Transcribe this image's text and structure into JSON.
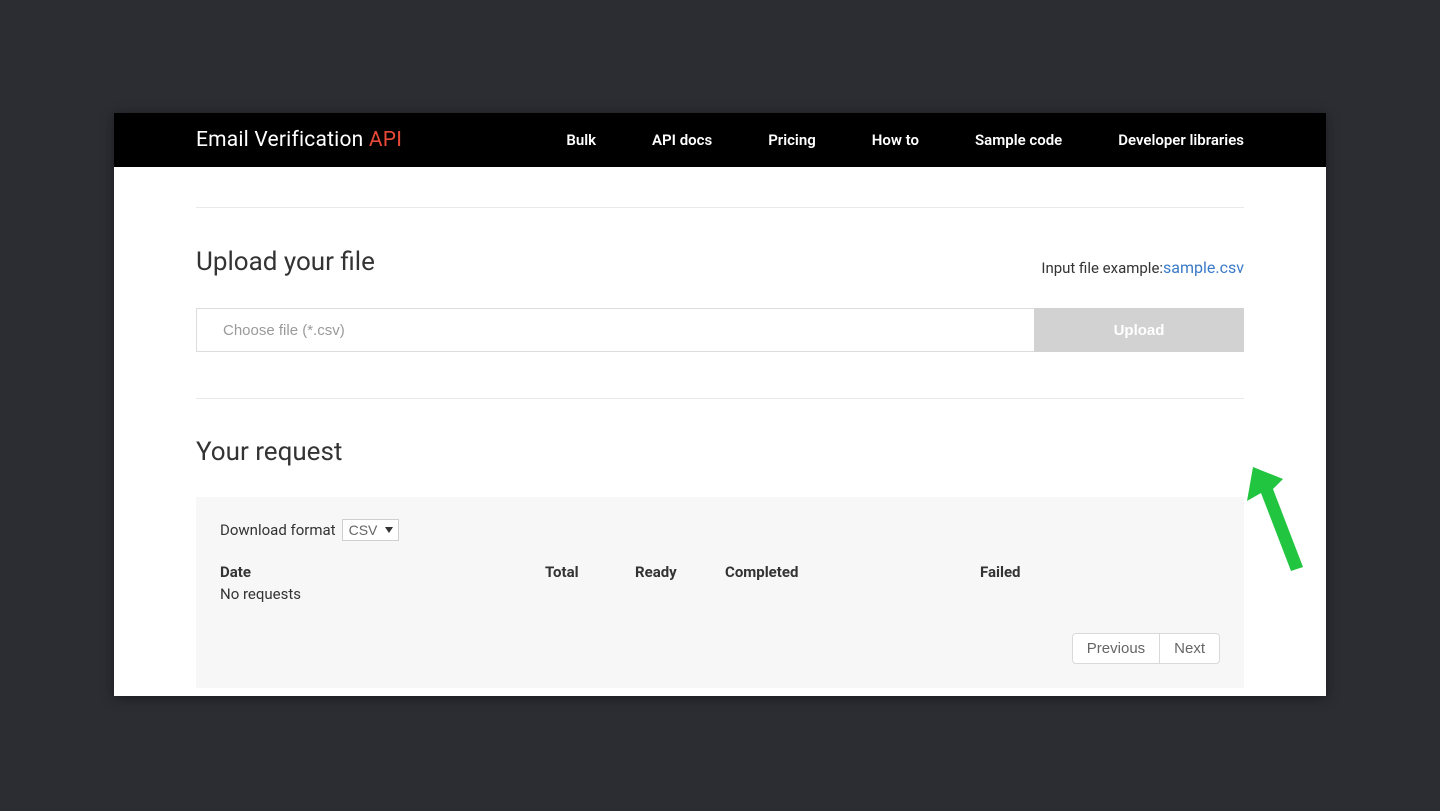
{
  "brand": {
    "main": "Email Verification ",
    "accent": "API"
  },
  "nav": {
    "items": [
      {
        "label": "Bulk"
      },
      {
        "label": "API docs"
      },
      {
        "label": "Pricing"
      },
      {
        "label": "How to"
      },
      {
        "label": "Sample code"
      },
      {
        "label": "Developer libraries"
      }
    ]
  },
  "upload": {
    "title": "Upload your file",
    "example_label": "Input file example:",
    "example_link": "sample.csv",
    "placeholder": "Choose file (*.csv)",
    "button": "Upload"
  },
  "requests": {
    "title": "Your request",
    "format_label": "Download format",
    "format_selected": "CSV",
    "columns": {
      "date": "Date",
      "total": "Total",
      "ready": "Ready",
      "completed": "Completed",
      "failed": "Failed"
    },
    "empty": "No requests",
    "prev": "Previous",
    "next": "Next"
  }
}
